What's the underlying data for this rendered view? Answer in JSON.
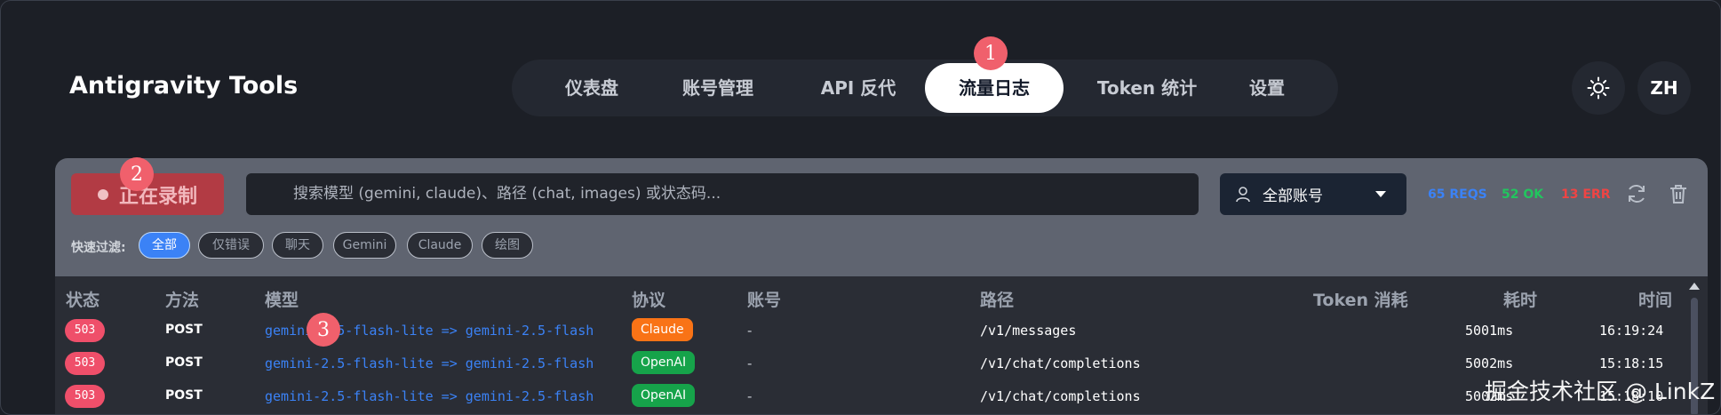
{
  "app": {
    "title": "Antigravity Tools"
  },
  "nav": {
    "tabs": [
      {
        "label": "仪表盘"
      },
      {
        "label": "账号管理"
      },
      {
        "label": "API 反代"
      },
      {
        "label": "流量日志",
        "active": true
      },
      {
        "label": "Token 统计"
      },
      {
        "label": "设置"
      }
    ]
  },
  "header_actions": {
    "theme_icon": "sun-icon",
    "lang_label": "ZH"
  },
  "annotations": {
    "m1": "1",
    "m2": "2",
    "m3": "3"
  },
  "toolbar": {
    "record_label": "正在录制",
    "search_placeholder": "搜索模型 (gemini, claude)、路径 (chat, images) 或状态码...",
    "account_select": "全部账号",
    "stats": {
      "reqs": "65 REQS",
      "ok": "52 OK",
      "err": "13 ERR"
    },
    "refresh_icon": "refresh-icon",
    "delete_icon": "trash-icon"
  },
  "filters": {
    "label": "快速过滤:",
    "chips": [
      {
        "label": "全部",
        "active": true
      },
      {
        "label": "仅错误"
      },
      {
        "label": "聊天"
      },
      {
        "label": "Gemini"
      },
      {
        "label": "Claude"
      },
      {
        "label": "绘图"
      }
    ]
  },
  "table": {
    "headers": {
      "status": "状态",
      "method": "方法",
      "model": "模型",
      "protocol": "协议",
      "account": "账号",
      "path": "路径",
      "tokens": "Token 消耗",
      "duration": "耗时",
      "time": "时间"
    },
    "rows": [
      {
        "status": "503",
        "method": "POST",
        "model": "gemini-2.5-flash-lite => gemini-2.5-flash",
        "protocol": "Claude",
        "account": "-",
        "path": "/v1/messages",
        "duration": "5001ms",
        "time": "16:19:24"
      },
      {
        "status": "503",
        "method": "POST",
        "model": "gemini-2.5-flash-lite => gemini-2.5-flash",
        "protocol": "OpenAI",
        "account": "-",
        "path": "/v1/chat/completions",
        "duration": "5002ms",
        "time": "15:18:15"
      },
      {
        "status": "503",
        "method": "POST",
        "model": "gemini-2.5-flash-lite => gemini-2.5-flash",
        "protocol": "OpenAI",
        "account": "-",
        "path": "/v1/chat/completions",
        "duration": "5002ms",
        "time": "15:18:10"
      }
    ]
  },
  "colors": {
    "accent_blue": "#3b82f6",
    "error_red": "#ef4444",
    "ok_green": "#22c55e",
    "claude_orange": "#f97316",
    "openai_green": "#16a34a"
  },
  "watermark": "掘金技术社区 @ LinkZ"
}
